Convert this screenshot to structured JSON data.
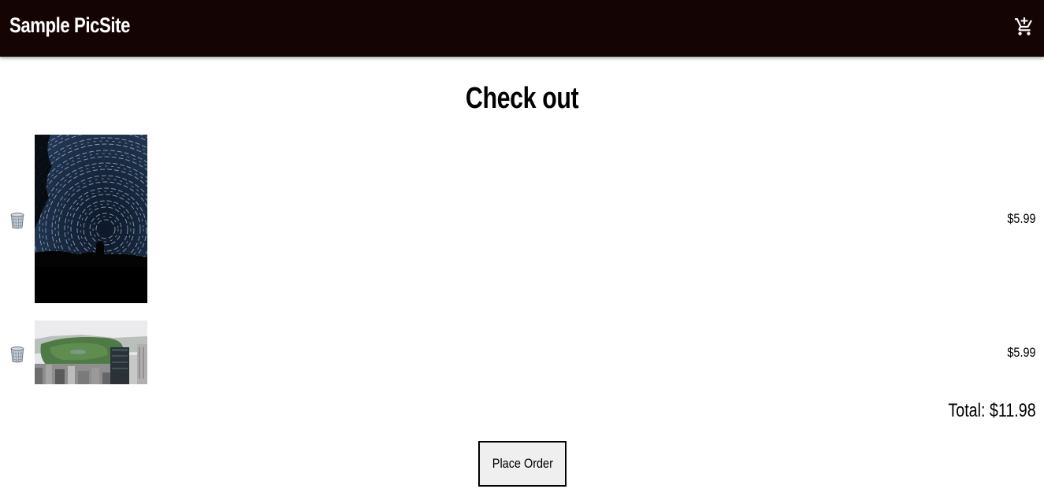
{
  "header": {
    "brand": "Sample PicSite",
    "cart_icon": "cart-plus-icon"
  },
  "page": {
    "title": "Check out"
  },
  "cart": {
    "items": [
      {
        "image": "star-trails-night-sky-photo",
        "price": "$5.99",
        "remove_icon": "trash-icon"
      },
      {
        "image": "central-park-aerial-city-photo",
        "price": "$5.99",
        "remove_icon": "trash-icon"
      }
    ],
    "total": "Total: $11.98"
  },
  "actions": {
    "place_order_label": "Place Order"
  }
}
